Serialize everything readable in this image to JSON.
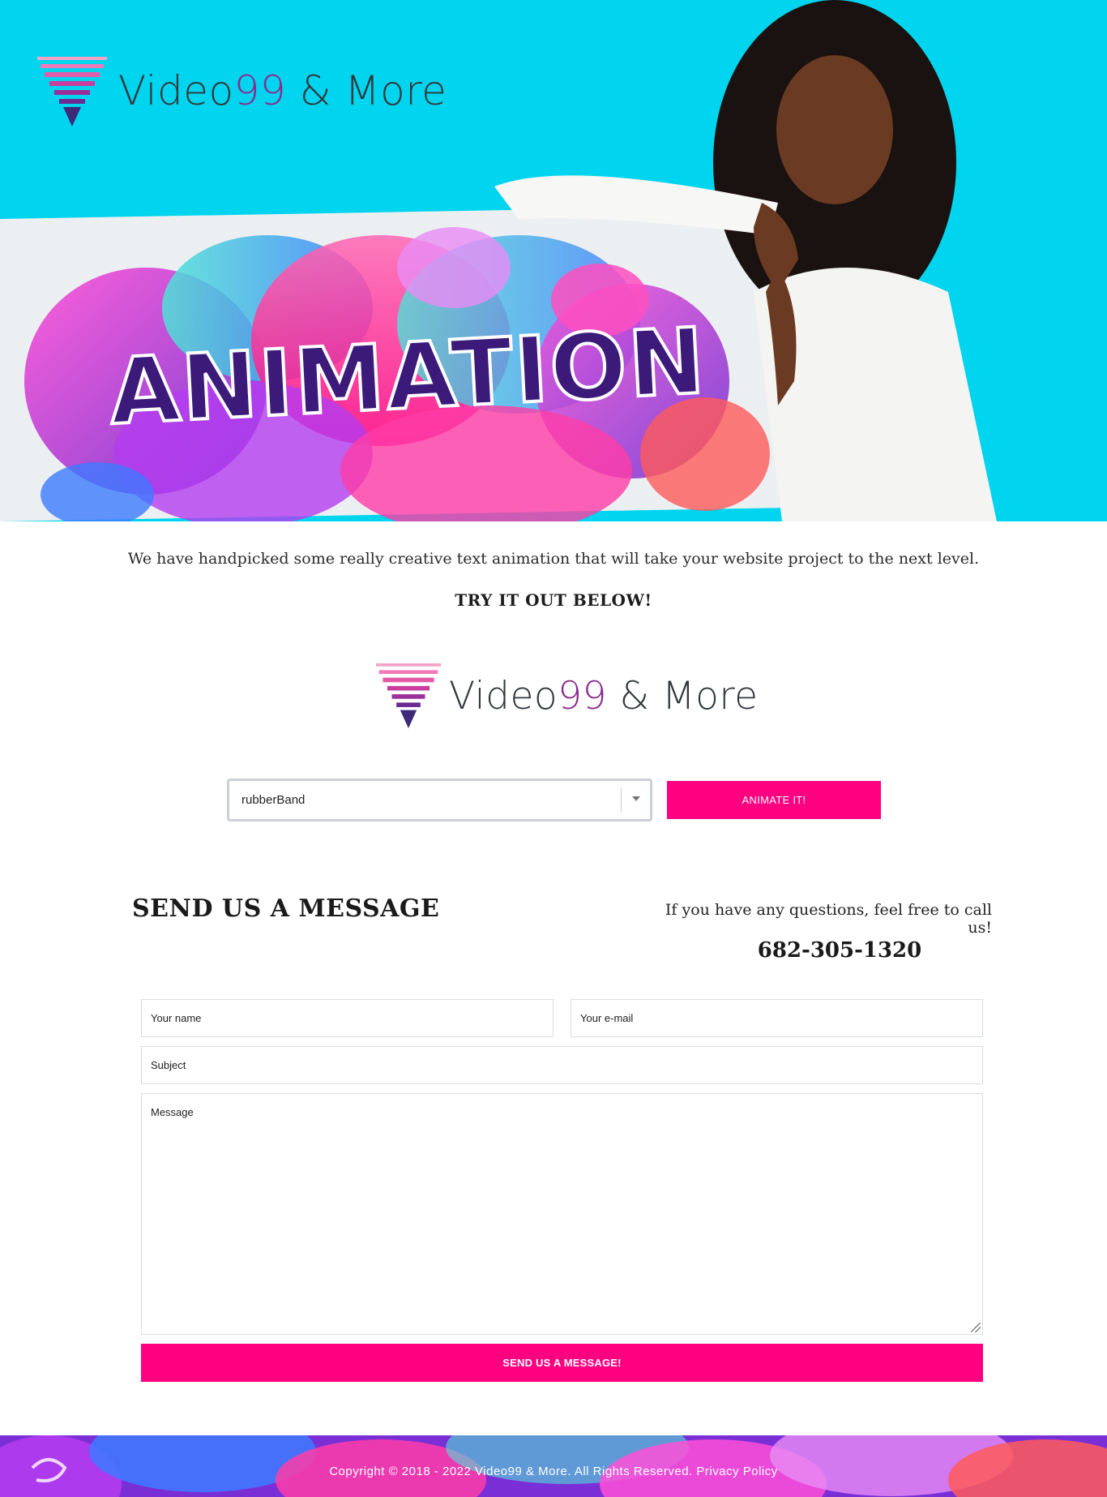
{
  "brand": {
    "name_prefix": "Video",
    "name_number": "99",
    "name_suffix": " & More",
    "accent_color": "#8b2a8f",
    "pink": "#ff0080"
  },
  "hero": {
    "word": "ANIMATION",
    "background_color": "#00d4ee"
  },
  "intro": {
    "text": "We have handpicked some really creative text animation that will take your website project to the next level.",
    "cta": "TRY IT OUT BELOW!"
  },
  "animator": {
    "selected_animation": "rubberBand",
    "button_label": "ANIMATE IT!"
  },
  "contact": {
    "title": "SEND US A MESSAGE",
    "call_text": "If you have any questions, feel free to call us!",
    "phone": "682-305-1320",
    "name_placeholder": "Your name",
    "email_placeholder": "Your e-mail",
    "subject_placeholder": "Subject",
    "message_placeholder": "Message",
    "submit_label": "SEND US A MESSAGE!"
  },
  "footer": {
    "copyright": "Copyright © 2018 - 2022 Video99 & More. All Rights Reserved.",
    "privacy_label": "Privacy Policy"
  }
}
